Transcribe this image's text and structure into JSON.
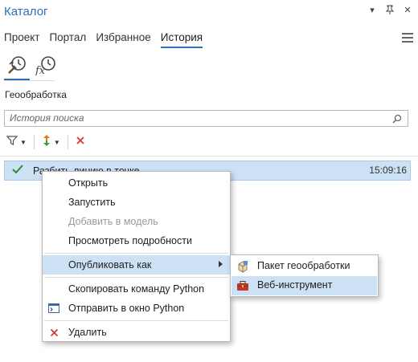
{
  "pane": {
    "title": "Каталог"
  },
  "tabs": [
    {
      "label": "Проект",
      "active": false
    },
    {
      "label": "Портал",
      "active": false
    },
    {
      "label": "Избранное",
      "active": false
    },
    {
      "label": "История",
      "active": true
    }
  ],
  "icon_tabs": [
    {
      "name": "geoprocessing-history-icon",
      "active": true
    },
    {
      "name": "function-history-icon",
      "label": "fx",
      "active": false
    }
  ],
  "section": {
    "label": "Геообработка"
  },
  "search": {
    "placeholder": "История поиска",
    "value": ""
  },
  "toolbar": {
    "icons": [
      "filter-icon",
      "sort-icon",
      "delete-icon"
    ]
  },
  "history": [
    {
      "name": "Разбить линию в точке",
      "time": "15:09:16",
      "status": "success"
    }
  ],
  "context_menu": {
    "items": [
      {
        "label": "Открыть",
        "enabled": true
      },
      {
        "label": "Запустить",
        "enabled": true
      },
      {
        "label": "Добавить в модель",
        "enabled": false
      },
      {
        "label": "Просмотреть подробности",
        "enabled": true
      },
      {
        "label": "Опубликовать как",
        "enabled": true,
        "highlighted": true,
        "submenu": true
      },
      {
        "label": "Скопировать команду Python",
        "enabled": true
      },
      {
        "label": "Отправить в окно Python",
        "enabled": true,
        "icon": "python-window-icon"
      },
      {
        "label": "Удалить",
        "enabled": true,
        "icon": "delete-icon"
      }
    ]
  },
  "submenu": {
    "items": [
      {
        "label": "Пакет геообработки",
        "icon": "geoprocessing-package-icon"
      },
      {
        "label": "Веб-инструмент",
        "icon": "web-tool-icon",
        "highlighted": true
      }
    ]
  },
  "colors": {
    "accent": "#2e6fb7",
    "highlight": "#cde1f5",
    "delete": "#d9362f",
    "check": "#2f8b3a"
  }
}
